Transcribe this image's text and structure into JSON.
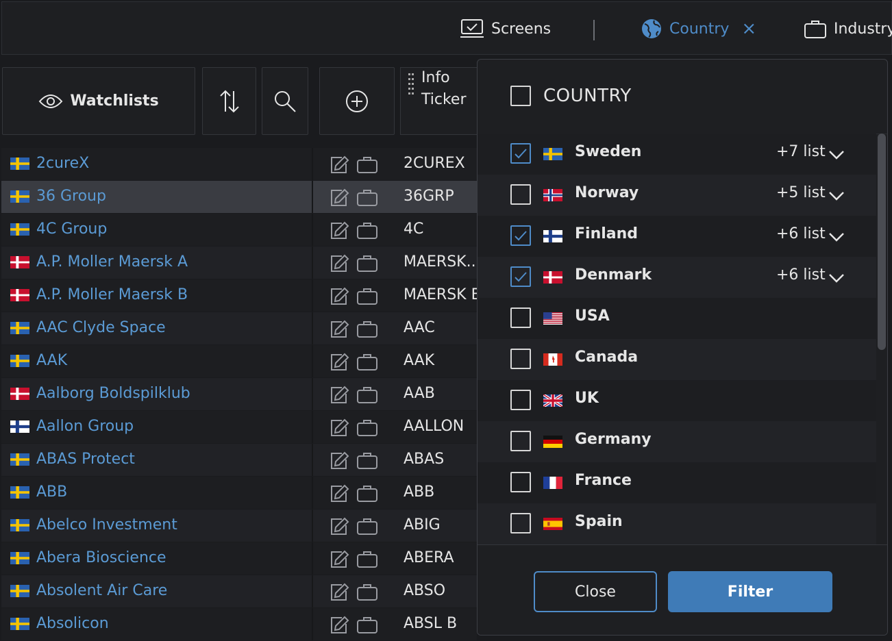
{
  "topbar": {
    "screens_label": "Screens",
    "country_label": "Country",
    "country_close": "×",
    "industry_label": "Industry"
  },
  "toolbar": {
    "watchlists_label": "Watchlists",
    "col_info": "Info",
    "col_ticker": "Ticker"
  },
  "companies": [
    {
      "name": "2cureX",
      "ticker": "2CUREX",
      "flag": "se"
    },
    {
      "name": "36 Group",
      "ticker": "36GRP",
      "flag": "se"
    },
    {
      "name": "4C Group",
      "ticker": "4C",
      "flag": "se"
    },
    {
      "name": "A.P. Moller Maersk A",
      "ticker": "MAERSK..",
      "flag": "dk"
    },
    {
      "name": "A.P. Moller Maersk B",
      "ticker": "MAERSK B",
      "flag": "dk"
    },
    {
      "name": "AAC Clyde Space",
      "ticker": "AAC",
      "flag": "se"
    },
    {
      "name": "AAK",
      "ticker": "AAK",
      "flag": "se"
    },
    {
      "name": "Aalborg Boldspilklub",
      "ticker": "AAB",
      "flag": "dk"
    },
    {
      "name": "Aallon Group",
      "ticker": "AALLON",
      "flag": "fi"
    },
    {
      "name": "ABAS Protect",
      "ticker": "ABAS",
      "flag": "se"
    },
    {
      "name": "ABB",
      "ticker": "ABB",
      "flag": "se"
    },
    {
      "name": "Abelco Investment",
      "ticker": "ABIG",
      "flag": "se"
    },
    {
      "name": "Abera Bioscience",
      "ticker": "ABERA",
      "flag": "se"
    },
    {
      "name": "Absolent Air Care",
      "ticker": "ABSO",
      "flag": "se"
    },
    {
      "name": "Absolicon",
      "ticker": "ABSL B",
      "flag": "se"
    }
  ],
  "selected_row": 1,
  "country_filter": {
    "title": "COUNTRY",
    "options": [
      {
        "name": "Sweden",
        "checked": true,
        "extra": "+7 list",
        "flag": "se"
      },
      {
        "name": "Norway",
        "checked": false,
        "extra": "+5 list",
        "flag": "no"
      },
      {
        "name": "Finland",
        "checked": true,
        "extra": "+6 list",
        "flag": "fi"
      },
      {
        "name": "Denmark",
        "checked": true,
        "extra": "+6 list",
        "flag": "dk"
      },
      {
        "name": "USA",
        "checked": false,
        "extra": "",
        "flag": "us"
      },
      {
        "name": "Canada",
        "checked": false,
        "extra": "",
        "flag": "ca"
      },
      {
        "name": "UK",
        "checked": false,
        "extra": "",
        "flag": "uk"
      },
      {
        "name": "Germany",
        "checked": false,
        "extra": "",
        "flag": "de"
      },
      {
        "name": "France",
        "checked": false,
        "extra": "",
        "flag": "fr"
      },
      {
        "name": "Spain",
        "checked": false,
        "extra": "",
        "flag": "es"
      }
    ],
    "close_label": "Close",
    "filter_label": "Filter"
  },
  "colors": {
    "accent": "#4f8cc9",
    "link": "#5b9bd5",
    "filter_button": "#3f7bb7"
  }
}
